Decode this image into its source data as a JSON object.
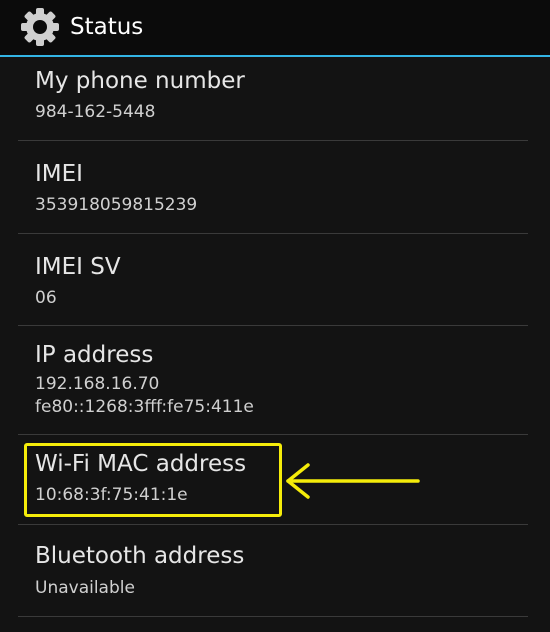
{
  "header": {
    "title": "Status",
    "icon": "gear-icon",
    "accent_color": "#33b5e5"
  },
  "items": [
    {
      "label": "My phone number",
      "values": [
        "984-162-5448"
      ]
    },
    {
      "label": "IMEI",
      "values": [
        "353918059815239"
      ]
    },
    {
      "label": "IMEI SV",
      "values": [
        "06"
      ]
    },
    {
      "label": "IP address",
      "values": [
        "192.168.16.70",
        "fe80::1268:3fff:fe75:411e"
      ]
    },
    {
      "label": "Wi-Fi MAC address",
      "values": [
        "10:68:3f:75:41:1e"
      ]
    },
    {
      "label": "Bluetooth address",
      "values": [
        "Unavailable"
      ]
    }
  ],
  "annotation": {
    "color": "#f5ec0a",
    "icon": "arrow-left-icon"
  }
}
